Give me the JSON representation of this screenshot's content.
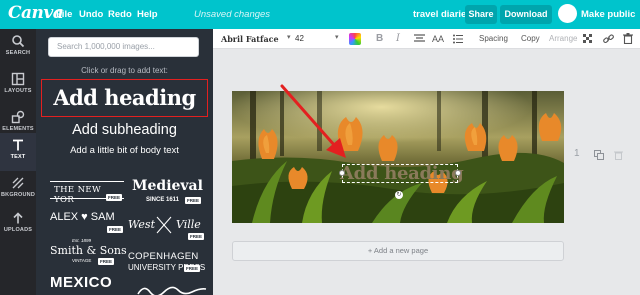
{
  "topbar": {
    "logo": "Canva",
    "menu": [
      "File",
      "Undo",
      "Redo",
      "Help"
    ],
    "unsaved": "Unsaved changes",
    "doc_title": "travel diaries",
    "share_label": "Share",
    "download_label": "Download",
    "make_public_label": "Make public",
    "bg_color": "#00c4cc"
  },
  "rail": {
    "items": [
      {
        "label": "SEARCH",
        "icon": "search-icon"
      },
      {
        "label": "LAYOUTS",
        "icon": "layouts-icon"
      },
      {
        "label": "ELEMENTS",
        "icon": "elements-icon"
      },
      {
        "label": "TEXT",
        "icon": "text-icon",
        "active": true
      },
      {
        "label": "BKGROUND",
        "icon": "background-icon"
      },
      {
        "label": "UPLOADS",
        "icon": "uploads-icon"
      }
    ]
  },
  "panel": {
    "search_placeholder": "Search 1,000,000 images...",
    "hint": "Click or drag to add text:",
    "add_heading": "Add heading",
    "add_subheading": "Add subheading",
    "add_body": "Add a little bit of body text",
    "free_badge": "FREE",
    "tiles": {
      "new_york": "THE NEW YOR",
      "medieval": "Medieval",
      "since": "SINCE 1611",
      "alex": "ALEX ♥ SAM",
      "west": "West",
      "ville": "Ville",
      "est": "Est. 1899",
      "smith": "Smith & Sons",
      "vintage": "VINTAGE",
      "copenhagen": "COPENHAGEN",
      "university": "UNIVERSITY PRESS",
      "mexico": "MEXICO"
    }
  },
  "toolbar": {
    "font": "Abril Fatface",
    "size": "42",
    "bold": "B",
    "italic": "I",
    "case": "AA",
    "spacing": "Spacing",
    "copy": "Copy",
    "arrange": "Arrange"
  },
  "canvas": {
    "heading_text": "Add heading",
    "page_number": "1",
    "add_page_label": "+ Add a new page"
  },
  "colors": {
    "arrow": "#e32020",
    "panel": "#293039"
  }
}
